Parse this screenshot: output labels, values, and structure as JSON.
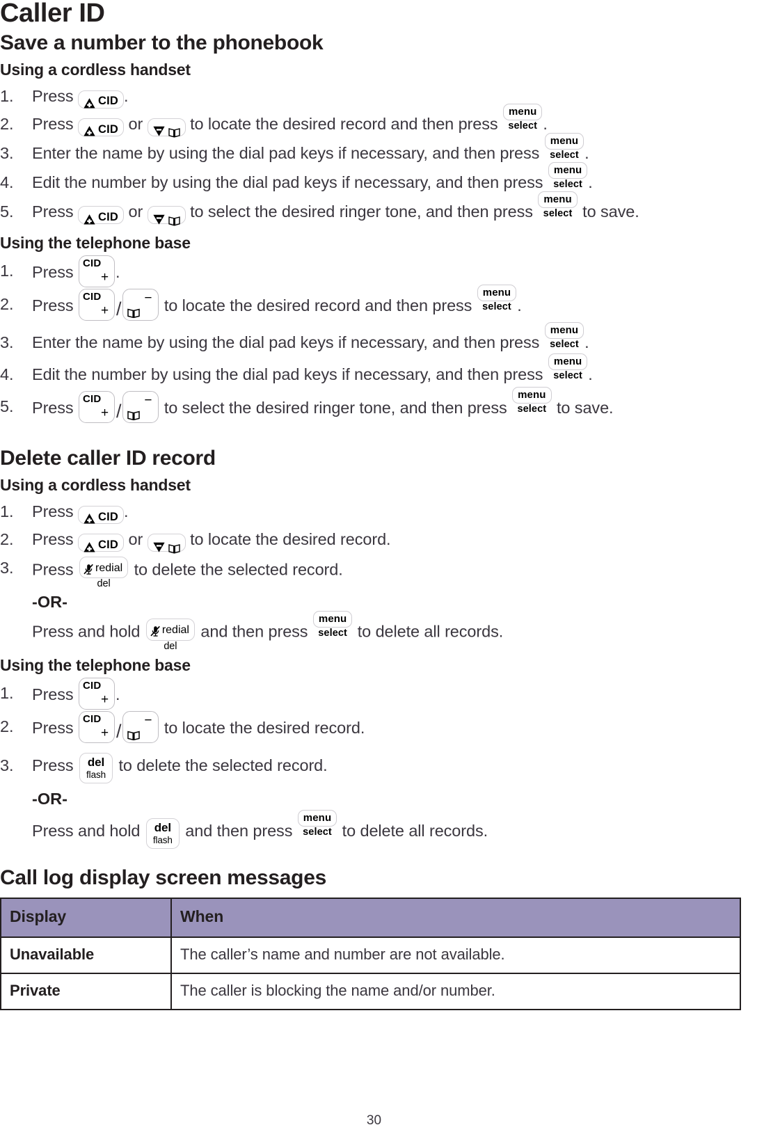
{
  "document": {
    "title": "Caller ID",
    "page_number": "30"
  },
  "sections": [
    {
      "heading": "Save a number to the phonebook",
      "subsections": [
        {
          "heading": "Using a cordless handset",
          "steps": [
            {
              "num": "1.",
              "before": "Press",
              "after": "."
            },
            {
              "num": "2.",
              "before": "Press",
              "mid1": "or",
              "mid2": "to locate the desired record and then press",
              "after": "."
            },
            {
              "num": "3.",
              "before": "Enter the name by using the dial pad keys if necessary, and then press",
              "after": "."
            },
            {
              "num": "4.",
              "before": "Edit the number by using the dial pad keys if necessary, and then press",
              "after": "."
            },
            {
              "num": "5.",
              "before": "Press",
              "mid1": "or",
              "mid2": "to select the desired ringer tone, and then press",
              "after": "to save."
            }
          ]
        },
        {
          "heading": "Using the telephone base",
          "steps": [
            {
              "num": "1.",
              "before": "Press",
              "after": "."
            },
            {
              "num": "2.",
              "before": "Press",
              "mid2": "to locate the desired record and then press",
              "after": "."
            },
            {
              "num": "3.",
              "before": "Enter the name by using the dial pad keys if necessary, and then press",
              "after": "."
            },
            {
              "num": "4.",
              "before": "Edit the number by using the dial pad keys if necessary, and then press",
              "after": "."
            },
            {
              "num": "5.",
              "before": "Press",
              "mid2": "to select the desired ringer tone, and then press",
              "after": "to save."
            }
          ]
        }
      ]
    },
    {
      "heading": "Delete caller ID record",
      "subsections": [
        {
          "heading": "Using a cordless handset",
          "steps": [
            {
              "num": "1.",
              "before": "Press",
              "after": "."
            },
            {
              "num": "2.",
              "before": "Press",
              "mid1": "or",
              "mid2": "to locate the desired record."
            },
            {
              "num": "3.",
              "before": "Press",
              "after": "to delete the selected record.",
              "or_label": "-OR-",
              "alt_before": "Press and hold",
              "alt_mid": "and then press",
              "alt_after": "to delete all records."
            }
          ]
        },
        {
          "heading": "Using the telephone base",
          "steps": [
            {
              "num": "1.",
              "before": "Press",
              "after": "."
            },
            {
              "num": "2.",
              "before": "Press",
              "mid2": "to locate the desired record."
            },
            {
              "num": "3.",
              "before": "Press",
              "after": "to delete the selected record.",
              "or_label": "-OR-",
              "alt_before": "Press and hold",
              "alt_mid": "and then press",
              "alt_after": "to delete all records."
            }
          ]
        }
      ]
    }
  ],
  "call_log_section": {
    "heading": "Call log display screen messages",
    "table": {
      "columns": [
        "Display",
        "When"
      ],
      "rows": [
        [
          "Unavailable",
          "The caller’s name and number are not available."
        ],
        [
          "Private",
          "The caller is blocking the name and/or number."
        ]
      ]
    }
  },
  "keys": {
    "cid_handset": {
      "label": "CID",
      "icon": "triangle-up-plus"
    },
    "down_book": {
      "icon_triangle": "triangle-down-minus",
      "icon_book": "phonebook"
    },
    "menu_select": {
      "top": "menu",
      "bottom": "select"
    },
    "base_cid_up": {
      "corner_label": "CID",
      "sign": "+"
    },
    "base_down": {
      "sign": "−",
      "icon_book": "phonebook"
    },
    "redial_del": {
      "label": "redial",
      "sub": "del",
      "icon": "mute-mic"
    },
    "del_flash": {
      "top": "del",
      "bottom": "flash"
    },
    "separator": "/"
  },
  "colors": {
    "table_header_bg": "#9a93bb",
    "table_border": "#231f20",
    "heading_text": "#231f20",
    "body_text": "#3b373f"
  }
}
